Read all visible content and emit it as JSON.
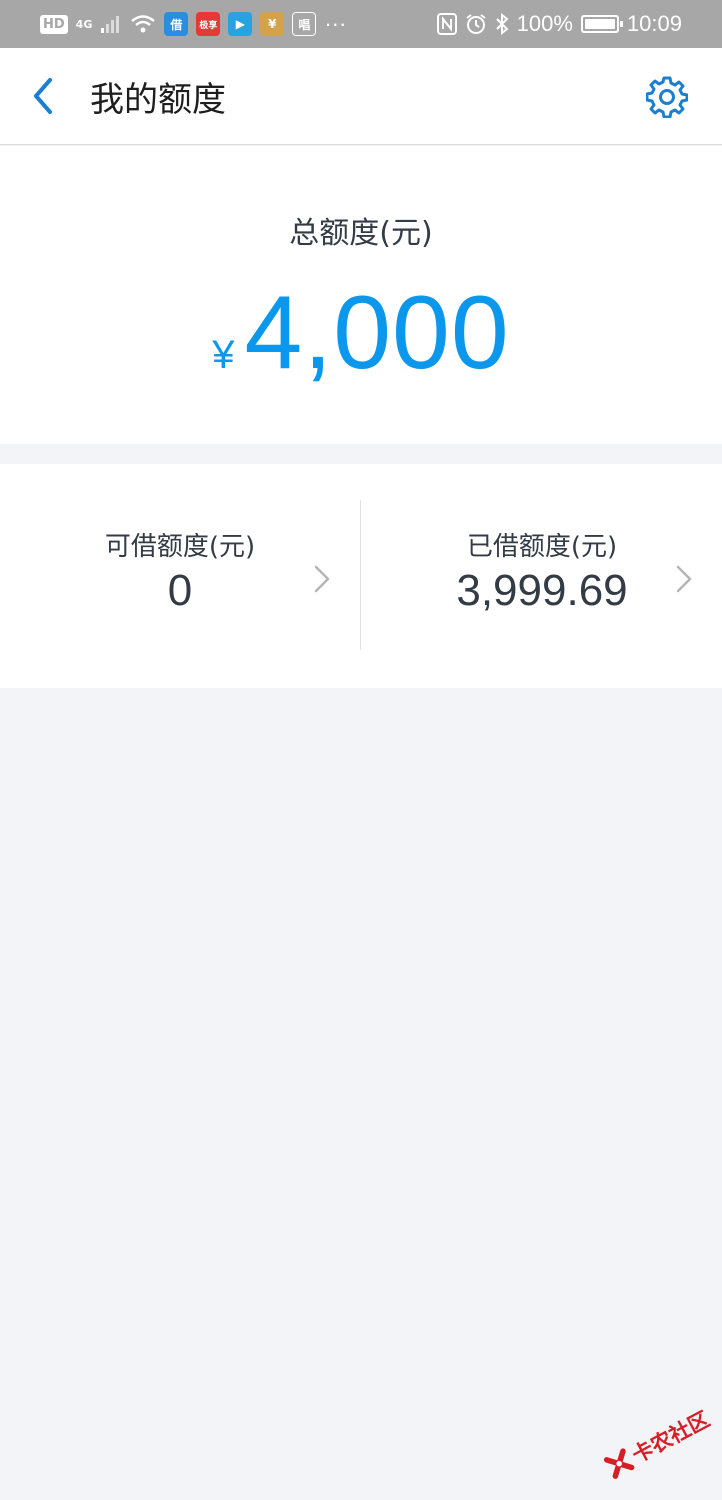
{
  "status_bar": {
    "left_badge": "HD",
    "network": "4G",
    "app_icons": [
      {
        "name": "jie-app-icon",
        "label": "借",
        "color": "#2a8de0"
      },
      {
        "name": "jisu-app-icon",
        "label": "极享",
        "color": "#e53935"
      },
      {
        "name": "play-app-icon",
        "label": "▶",
        "color": "#29a3e0"
      },
      {
        "name": "money-bag-app-icon",
        "label": "¥",
        "color": "#d3a24a"
      },
      {
        "name": "chang-app-icon",
        "label": "唱",
        "color": "#a7a7a7"
      }
    ],
    "more": "···",
    "battery": "100%",
    "battery_level": 1.0,
    "time": "10:09"
  },
  "header": {
    "title": "我的额度",
    "back_icon": "chevron-left-icon",
    "settings_icon": "gear-icon",
    "accent_color": "#1b7fd1"
  },
  "total": {
    "label": "总额度(元)",
    "currency": "¥",
    "amount": "4,000",
    "color": "#0a97ec"
  },
  "split": {
    "available_label": "可借额度(元)",
    "available_value": "0",
    "borrowed_label": "已借额度(元)",
    "borrowed_value": "3,999.69"
  },
  "watermark": {
    "text": "卡农社区"
  }
}
